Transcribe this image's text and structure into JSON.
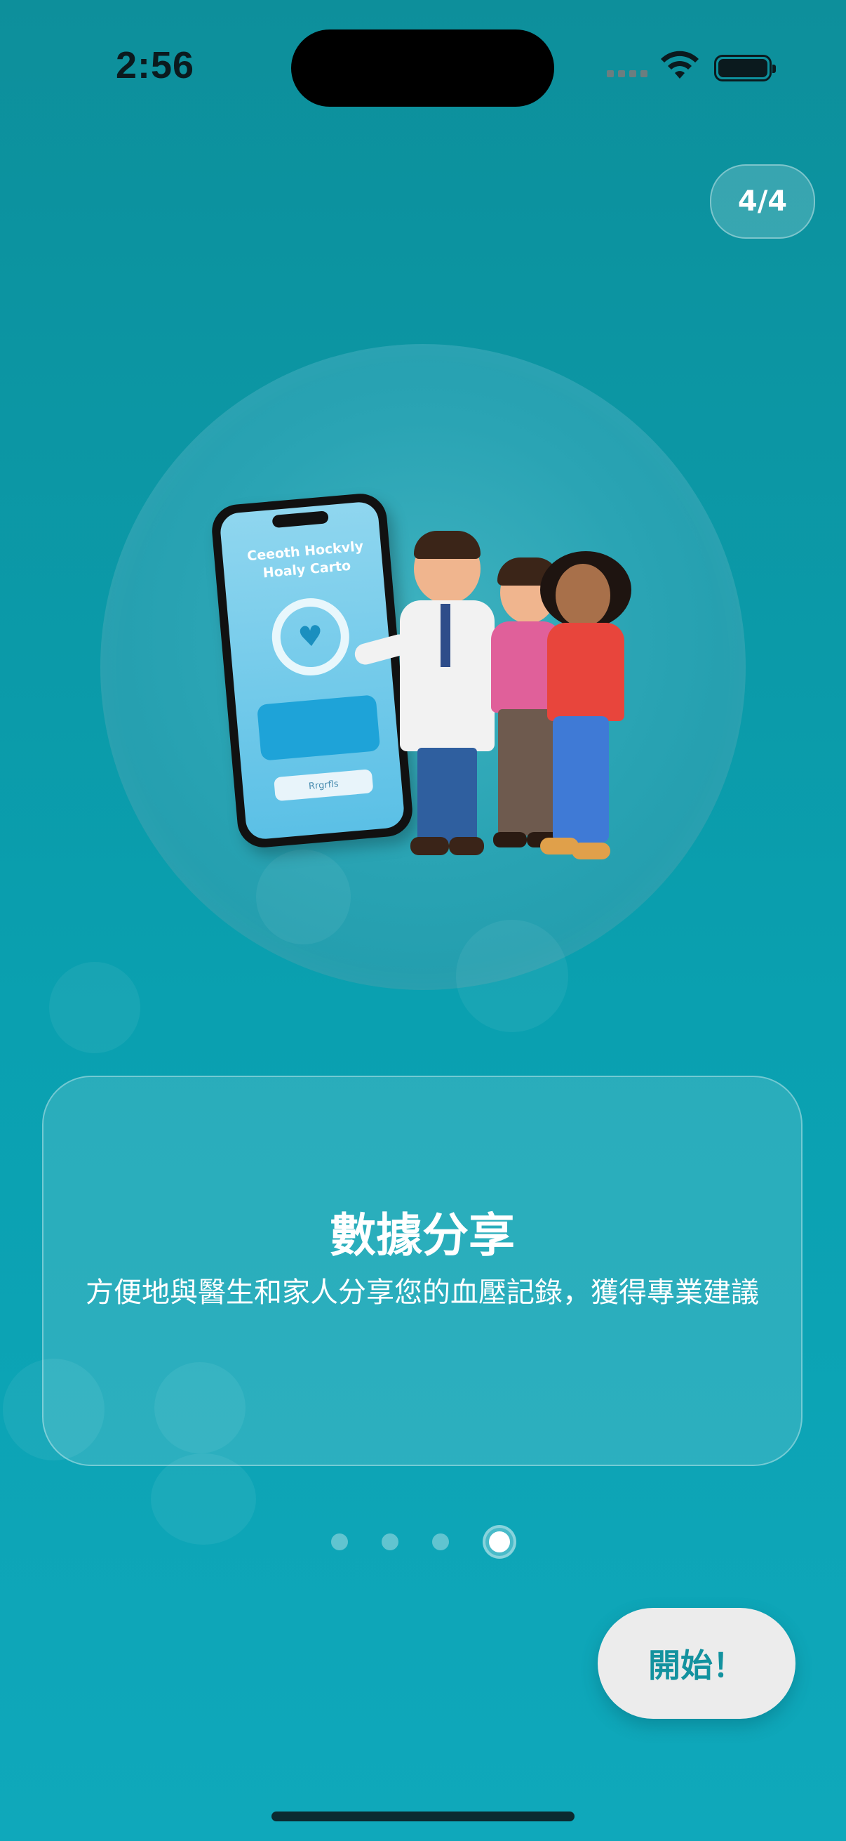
{
  "status_bar": {
    "time": "2:56"
  },
  "page_indicator": {
    "label": "4/4",
    "current": 4,
    "total": 4
  },
  "illustration": {
    "phone_title": "Ceeoth Hockvly\nHoaly Carto",
    "phone_button": "Rrgrfls"
  },
  "card": {
    "title": "數據分享",
    "description": "方便地與醫生和家人分享您的血壓記錄，獲得專業建議"
  },
  "pagination": {
    "count": 4,
    "active_index": 3
  },
  "start_button": {
    "label": "開始！"
  },
  "colors": {
    "background": "#0aa0b0",
    "accent": "#13929f",
    "button_bg": "#ececec"
  }
}
